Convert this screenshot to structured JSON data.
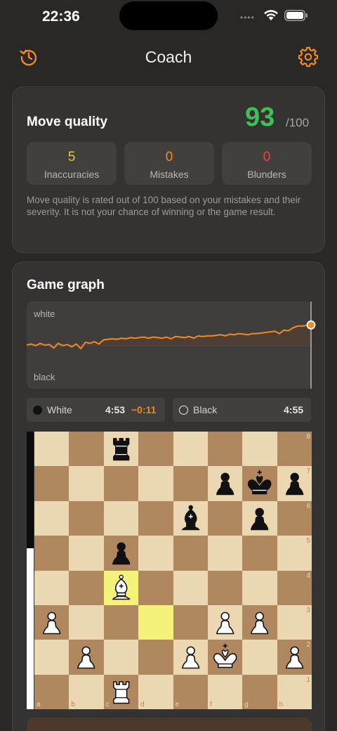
{
  "status_bar": {
    "time": "22:36"
  },
  "header": {
    "title": "Coach",
    "left_icon": "history-icon",
    "right_icon": "gear-icon",
    "accent_color": "#f08a24"
  },
  "move_quality": {
    "title": "Move quality",
    "score": "93",
    "max": "/100",
    "stats": [
      {
        "value": "5",
        "label": "Inaccuracies",
        "color": "#e7c43c"
      },
      {
        "value": "0",
        "label": "Mistakes",
        "color": "#f08a24"
      },
      {
        "value": "0",
        "label": "Blunders",
        "color": "#e8443a"
      }
    ],
    "description": "Move quality is rated out of 100 based on your mistakes and their severity. It is not your chance of winning or the game result."
  },
  "game_graph": {
    "title": "Game graph",
    "top_label": "white",
    "bottom_label": "black",
    "eval_series": [
      0.0,
      0.02,
      -0.01,
      0.03,
      0.0,
      0.01,
      -0.05,
      0.03,
      -0.01,
      0.01,
      -0.03,
      0.02,
      -0.06,
      0.05,
      0.03,
      0.06,
      0.02,
      0.09,
      0.1,
      0.11,
      0.1,
      0.12,
      0.11,
      0.13,
      0.12,
      0.13,
      0.14,
      0.12,
      0.14,
      0.13,
      0.12,
      0.14,
      0.11,
      0.15,
      0.14,
      0.13,
      0.15,
      0.12,
      0.16,
      0.15,
      0.16,
      0.16,
      0.17,
      0.18,
      0.16,
      0.19,
      0.18,
      0.2,
      0.19,
      0.18,
      0.2,
      0.2,
      0.21,
      0.22,
      0.23,
      0.24,
      0.2,
      0.26,
      0.25,
      0.3,
      0.33,
      0.33,
      0.34,
      0.35
    ]
  },
  "players": {
    "white": {
      "name": "White",
      "time": "4:53",
      "diff": "−0:11"
    },
    "black": {
      "name": "Black",
      "time": "4:55"
    }
  },
  "board": {
    "eval_white_fraction": 0.58,
    "highlight_squares": [
      "c4",
      "d3"
    ],
    "pieces": [
      {
        "square": "c8",
        "type": "rook",
        "color": "black"
      },
      {
        "square": "f7",
        "type": "pawn",
        "color": "black"
      },
      {
        "square": "g7",
        "type": "king",
        "color": "black"
      },
      {
        "square": "h7",
        "type": "pawn",
        "color": "black"
      },
      {
        "square": "e6",
        "type": "bishop",
        "color": "black"
      },
      {
        "square": "g6",
        "type": "pawn",
        "color": "black"
      },
      {
        "square": "c5",
        "type": "pawn",
        "color": "black"
      },
      {
        "square": "c4",
        "type": "bishop",
        "color": "white"
      },
      {
        "square": "a3",
        "type": "pawn",
        "color": "white"
      },
      {
        "square": "f3",
        "type": "pawn",
        "color": "white"
      },
      {
        "square": "g3",
        "type": "pawn",
        "color": "white"
      },
      {
        "square": "b2",
        "type": "pawn",
        "color": "white"
      },
      {
        "square": "e2",
        "type": "pawn",
        "color": "white"
      },
      {
        "square": "f2",
        "type": "king",
        "color": "white"
      },
      {
        "square": "h2",
        "type": "pawn",
        "color": "white"
      },
      {
        "square": "c1",
        "type": "rook",
        "color": "white"
      }
    ],
    "ranks": [
      "8",
      "7",
      "6",
      "5",
      "4",
      "3",
      "2",
      "1"
    ],
    "files": [
      "a",
      "b",
      "c",
      "d",
      "e",
      "f",
      "g",
      "h"
    ]
  }
}
